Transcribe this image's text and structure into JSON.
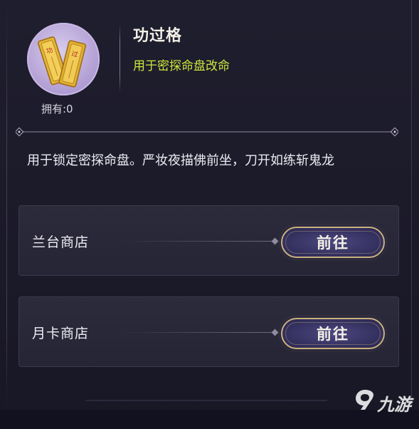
{
  "item": {
    "title": "功过格",
    "subtitle": "用于密探命盘改命",
    "owned_label": "拥有:0",
    "icon": "scroll-tablets-icon",
    "description": "用于锁定密探命盘。严妆夜描佛前坐，刀开如练斩鬼龙"
  },
  "shops": [
    {
      "name": "兰台商店",
      "button_label": "前往"
    },
    {
      "name": "月卡商店",
      "button_label": "前往"
    }
  ],
  "watermark": {
    "text": "九游",
    "icon": "9game-logo-icon"
  },
  "colors": {
    "subtitle": "#cde63c",
    "button_border": "#c9b27a",
    "button_fill": "#363261",
    "background": "#1c1b2a"
  }
}
